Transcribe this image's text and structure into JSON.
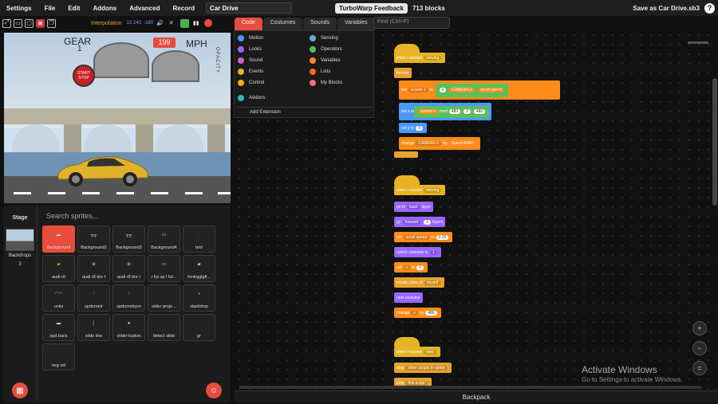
{
  "menubar": {
    "settings": "Settings",
    "file": "File",
    "edit": "Edit",
    "addons": "Addons",
    "advanced": "Advanced",
    "record": "Record",
    "project_title": "Car Drive",
    "feedback": "TurboWarp Feedback",
    "block_count": "713 blocks",
    "save_as": "Save as Car Drive.sb3",
    "help": "?"
  },
  "stagebar": {
    "interpolation": "Interpolation",
    "cursor_position": "13  240, -180"
  },
  "stage_view": {
    "gear_label": "GEAR",
    "gear_value": "1",
    "speed_value": "199",
    "speed_unit": "MPH",
    "start_button": "START STOP",
    "opacity_label": "OPACITY"
  },
  "stage_panel": {
    "label": "Stage",
    "backdrops_label": "Backdrops",
    "backdrops_count": "3"
  },
  "sprites": {
    "search_placeholder": "Search sprites...",
    "items": [
      {
        "name": "Background"
      },
      {
        "name": "Background2"
      },
      {
        "name": "Background3"
      },
      {
        "name": "Background4"
      },
      {
        "name": "text"
      },
      {
        "name": "audi r8"
      },
      {
        "name": "audi r8 tire f"
      },
      {
        "name": "audi r8 tire r"
      },
      {
        "name": "r fut up l fut..."
      },
      {
        "name": "fontrgglgfl..."
      },
      {
        "name": "units"
      },
      {
        "name": "spdometr"
      },
      {
        "name": "spdometrpm"
      },
      {
        "name": "older proje..."
      },
      {
        "name": "start/stop"
      },
      {
        "name": "spd back"
      },
      {
        "name": "slide line"
      },
      {
        "name": "slider button"
      },
      {
        "name": "detect slide"
      },
      {
        "name": "gr"
      },
      {
        "name": "neg vel"
      }
    ]
  },
  "editor_tabs": {
    "code": "Code",
    "costumes": "Costumes",
    "sounds": "Sounds",
    "variables": "Variables"
  },
  "find": {
    "placeholder": "Find (Ctrl+F)"
  },
  "categories": {
    "motion": "Motion",
    "looks": "Looks",
    "sound": "Sound",
    "events": "Events",
    "control": "Control",
    "addons": "Addons",
    "sensing": "Sensing",
    "operators": "Operators",
    "variables": "Variables",
    "lists": "Lists",
    "my_blocks": "My Blocks",
    "add_extension": "Add Extension"
  },
  "scripts": {
    "s1": {
      "hat": "when I receive",
      "hat_msg": "moving",
      "forever": "forever",
      "set": "set",
      "screen_x": "screen x",
      "to": "to",
      "x": "x",
      "camera_x": "CAMERA X",
      "scroll_speed": "scroll speed",
      "set_x_to": "set x to",
      "mod": "mod",
      "v480": "480",
      "v2": "2",
      "v_480": "480",
      "set_y_to": "set y to",
      "v0": "0",
      "change": "change",
      "camera_x2": "CAMERA X",
      "by": "by",
      "speed_kmh": "Speed KM/H"
    },
    "s2": {
      "hat": "when I receive",
      "hat_msg": "moving",
      "go_to": "go to",
      "back": "back",
      "layer": "layer",
      "go": "go",
      "forward": "forward",
      "v1": "1",
      "layers": "layers",
      "set": "set",
      "scroll_speed": "scroll speed",
      "to": "to",
      "v025": "0.25",
      "switch_costume": "switch costume to",
      "costume_val": "1",
      "set2": "set",
      "x": "x",
      "to2": "to",
      "v0": "0",
      "create_clone": "create clone of",
      "myself": "myself",
      "next_costume": "next costume",
      "change": "change",
      "x2": "x",
      "by": "by",
      "v480": "480"
    },
    "s3": {
      "hat": "when I receive",
      "hat_msg": "stop",
      "stop": "stop",
      "other_scripts": "other scripts in sprite",
      "stop2": "stop",
      "this_script": "this script"
    }
  },
  "backpack": "Backpack",
  "watermark": {
    "title": "Activate Windows",
    "sub": "Go to Settings to activate Windows."
  },
  "colors": {
    "accent": "#e74c3c",
    "events": "#e6b422",
    "motion": "#4c97ff",
    "looks": "#9966ff",
    "operators": "#59c059",
    "variables": "#ff8c1a"
  }
}
